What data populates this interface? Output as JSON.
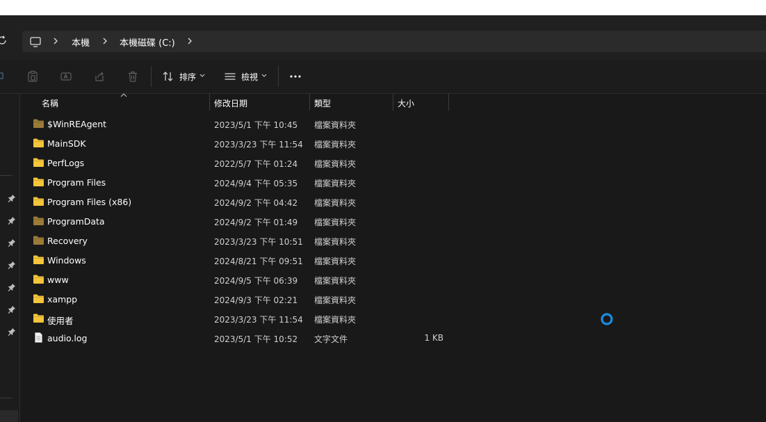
{
  "address_bar": {
    "crumbs": [
      "本機",
      "本機磁碟 (C:)"
    ]
  },
  "toolbar": {
    "sort_label": "排序",
    "view_label": "檢視"
  },
  "columns": {
    "name": "名稱",
    "modified": "修改日期",
    "type": "類型",
    "size": "大小"
  },
  "files": [
    {
      "name": "$WinREAgent",
      "modified": "2023/5/1 下午 10:45",
      "type": "檔案資料夾",
      "size": "",
      "icon": "folder-dim-icon"
    },
    {
      "name": "MainSDK",
      "modified": "2023/3/23 下午 11:54",
      "type": "檔案資料夾",
      "size": "",
      "icon": "folder-icon"
    },
    {
      "name": "PerfLogs",
      "modified": "2022/5/7 下午 01:24",
      "type": "檔案資料夾",
      "size": "",
      "icon": "folder-icon"
    },
    {
      "name": "Program Files",
      "modified": "2024/9/4 下午 05:35",
      "type": "檔案資料夾",
      "size": "",
      "icon": "folder-icon"
    },
    {
      "name": "Program Files (x86)",
      "modified": "2024/9/2 下午 04:42",
      "type": "檔案資料夾",
      "size": "",
      "icon": "folder-icon"
    },
    {
      "name": "ProgramData",
      "modified": "2024/9/2 下午 01:49",
      "type": "檔案資料夾",
      "size": "",
      "icon": "folder-dim-icon"
    },
    {
      "name": "Recovery",
      "modified": "2023/3/23 下午 10:51",
      "type": "檔案資料夾",
      "size": "",
      "icon": "folder-dim-icon"
    },
    {
      "name": "Windows",
      "modified": "2024/8/21 下午 09:51",
      "type": "檔案資料夾",
      "size": "",
      "icon": "folder-icon"
    },
    {
      "name": "www",
      "modified": "2024/9/5 下午 06:39",
      "type": "檔案資料夾",
      "size": "",
      "icon": "folder-icon"
    },
    {
      "name": "xampp",
      "modified": "2024/9/3 下午 02:21",
      "type": "檔案資料夾",
      "size": "",
      "icon": "folder-icon"
    },
    {
      "name": "使用者",
      "modified": "2023/3/23 下午 11:54",
      "type": "檔案資料夾",
      "size": "",
      "icon": "folder-icon"
    },
    {
      "name": "audio.log",
      "modified": "2023/5/1 下午 10:52",
      "type": "文字文件",
      "size": "1 KB",
      "icon": "document-icon"
    }
  ],
  "colors": {
    "folder": "#f4c53a",
    "folder_dim": "#9a7b38",
    "accent": "#1b8de0"
  }
}
